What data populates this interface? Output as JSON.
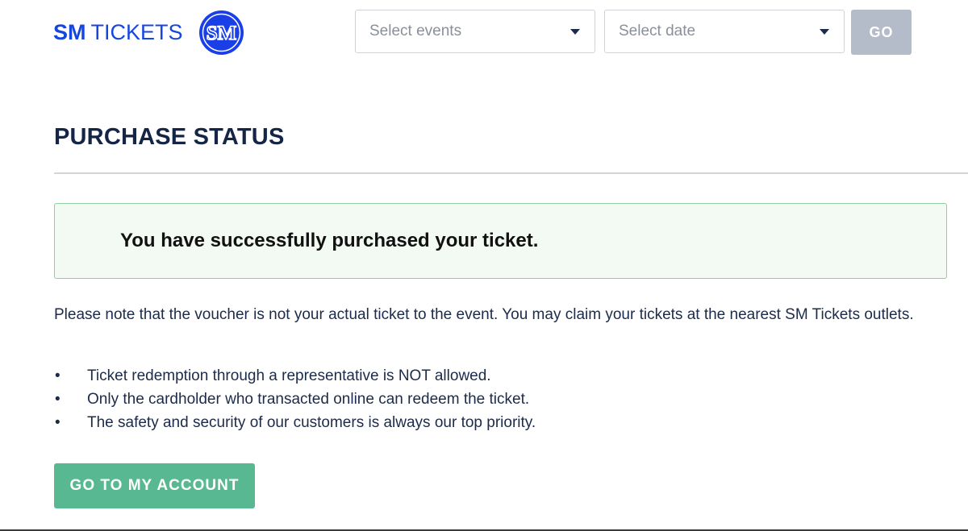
{
  "header": {
    "logo_sm": "SM",
    "logo_tickets": "TICKETS",
    "logo_badge_text": "SM",
    "events_select": {
      "selected": "Select events"
    },
    "date_select": {
      "selected": "Select date"
    },
    "go_label": "GO"
  },
  "main": {
    "title": "PURCHASE STATUS",
    "success_message": "You have successfully purchased your ticket.",
    "note": "Please note that the voucher is not your actual ticket to the event. You may claim your tickets at the nearest SM Tickets outlets.",
    "bullets": [
      "Ticket redemption through a representative is NOT allowed.",
      "Only the cardholder who transacted online can redeem the ticket.",
      "The safety and security of our customers is always our top priority."
    ],
    "account_button": "GO TO MY ACCOUNT"
  },
  "colors": {
    "brand_blue": "#1646e0",
    "go_disabled": "#b3bcc8",
    "success_border": "#8fcf9e",
    "success_bg": "#f3faf4",
    "account_green": "#58b891",
    "text_navy": "#142546"
  },
  "icons": {
    "logo": "sm-logo-icon",
    "dropdown": "caret-down-icon"
  }
}
